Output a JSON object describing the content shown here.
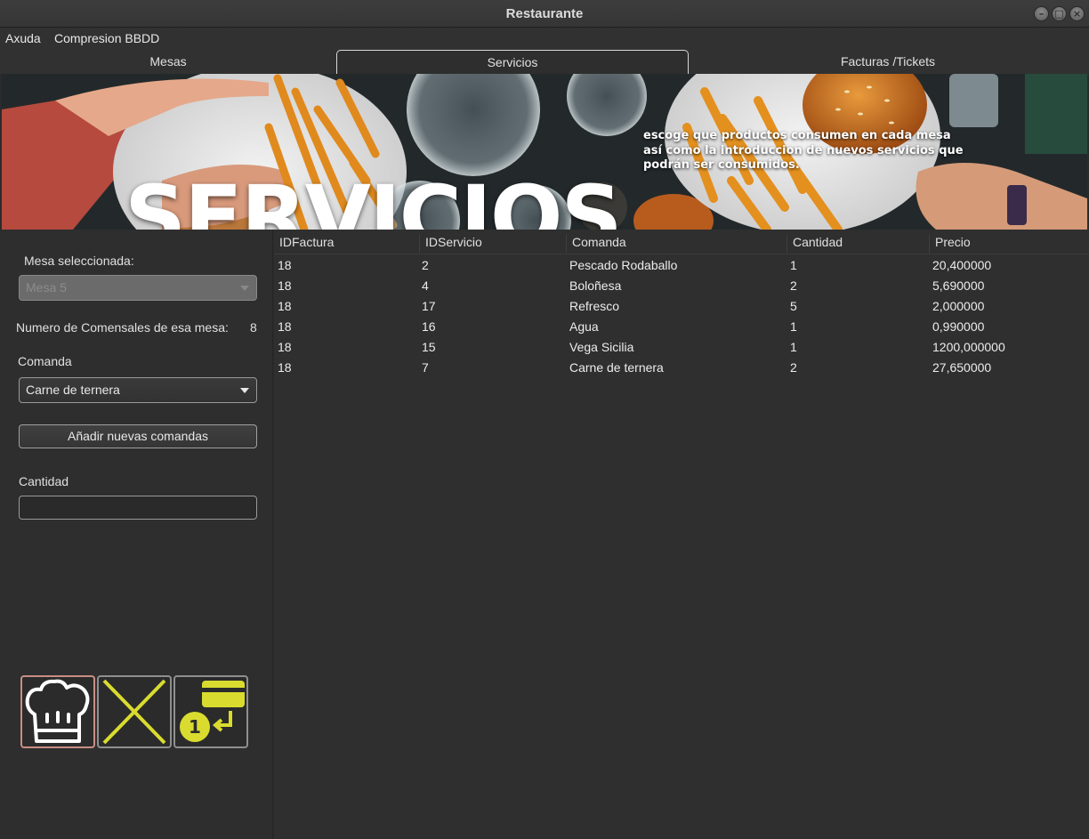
{
  "window": {
    "title": "Restaurante"
  },
  "menu": {
    "items": [
      "Axuda",
      "Compresion BBDD"
    ]
  },
  "tabs": [
    {
      "label": "Mesas",
      "active": false
    },
    {
      "label": "Servicios",
      "active": true
    },
    {
      "label": "Facturas /Tickets",
      "active": false
    }
  ],
  "banner": {
    "heading": "SERVICIOS",
    "description_lines": [
      "escoge que productos consumen en cada mesa",
      "así como la introduccion de nuevos servicios que",
      "podrán ser consumidos."
    ]
  },
  "left_panel": {
    "mesa_label": "Mesa seleccionada:",
    "mesa_value": "Mesa 5",
    "comensales_label": "Numero de Comensales de esa mesa:",
    "comensales_value": "8",
    "comanda_label": "Comanda",
    "comanda_value": "Carne de ternera",
    "add_button": "Añadir nuevas comandas",
    "cantidad_label": "Cantidad",
    "cantidad_value": "",
    "action_icons": [
      "chef-hat-icon",
      "cross-icon",
      "payment-card-icon"
    ],
    "accent_color": "#d9dc2f"
  },
  "table": {
    "columns": [
      "IDFactura",
      "IDServicio",
      "Comanda",
      "Cantidad",
      "Precio"
    ],
    "rows": [
      [
        "18",
        "2",
        "Pescado Rodaballo",
        "1",
        "20,400000"
      ],
      [
        "18",
        "4",
        "Boloñesa",
        "2",
        "5,690000"
      ],
      [
        "18",
        "17",
        "Refresco",
        "5",
        "2,000000"
      ],
      [
        "18",
        "16",
        "Agua",
        "1",
        "0,990000"
      ],
      [
        "18",
        "15",
        "Vega Sicilia",
        "1",
        "1200,000000"
      ],
      [
        "18",
        "7",
        "Carne de ternera",
        "2",
        "27,650000"
      ]
    ]
  }
}
